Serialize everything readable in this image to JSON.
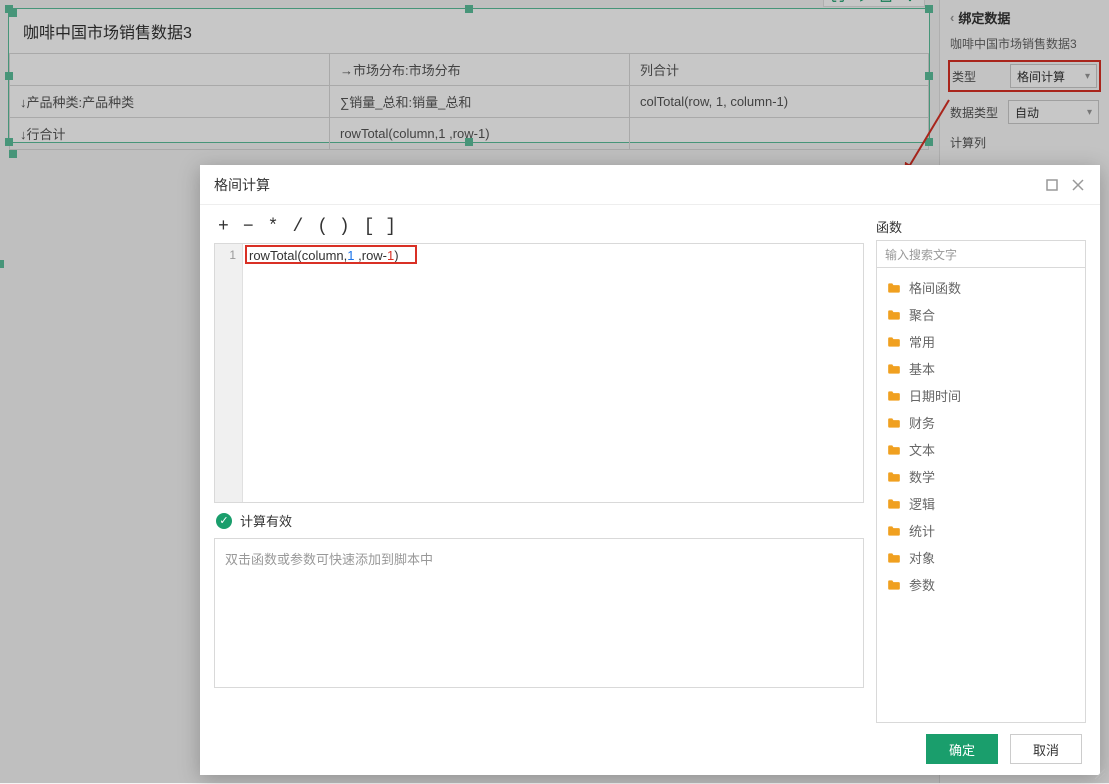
{
  "widget": {
    "title": "咖啡中国市场销售数据3",
    "table": {
      "r0c1": "→市场分布:市场分布",
      "r0c2": "列合计",
      "r1c0": "↓产品种类:产品种类",
      "r1c1": "∑销量_总和:销量_总和",
      "r1c2": "colTotal(row, 1, column-1)",
      "r2c0": "↓行合计",
      "r2c1": "rowTotal(column,1 ,row-1)",
      "r2c2": ""
    }
  },
  "sidebar": {
    "header": "绑定数据",
    "subtitle": "咖啡中国市场销售数据3",
    "type_label": "类型",
    "type_value": "格间计算",
    "datatype_label": "数据类型",
    "datatype_value": "自动",
    "calc_col_label": "计算列"
  },
  "dialog": {
    "title": "格间计算",
    "ops": {
      "plus": "+",
      "minus": "−",
      "star": "*",
      "slash": "/",
      "paren": "( )",
      "bracket": "[ ]"
    },
    "code_line_no": "1",
    "code_parts": {
      "fn": "rowTotal",
      "open": "(column,",
      "n1": "1",
      "mid": " ,row-",
      "n2": "1",
      "close": ")"
    },
    "valid_text": "计算有效",
    "help_placeholder": "双击函数或参数可快速添加到脚本中",
    "fn_label": "函数",
    "fn_search_placeholder": "输入搜索文字",
    "fn_categories": [
      "格间函数",
      "聚合",
      "常用",
      "基本",
      "日期时间",
      "财务",
      "文本",
      "数学",
      "逻辑",
      "统计",
      "对象",
      "参数"
    ],
    "ok": "确定",
    "cancel": "取消"
  }
}
